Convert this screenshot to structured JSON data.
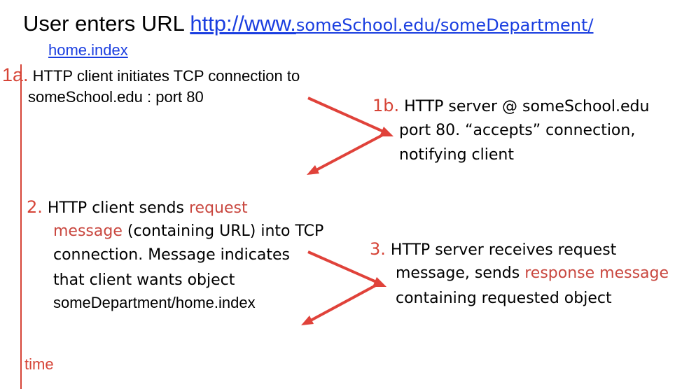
{
  "header": {
    "prefix": "User enters URL ",
    "url_part1": "http://www.",
    "url_part2": "someSchool.edu/someDepartment/",
    "url_part3": "home.index"
  },
  "step1a": {
    "num": "1a.",
    "line1": " HTTP client initiates TCP connection to",
    "line2": "someSchool.edu : port 80"
  },
  "step1b": {
    "num": "1b.",
    "line1": " HTTP server @ someSchool.edu",
    "line2": "port 80.  “accepts” connection,",
    "line3": "notifying client"
  },
  "step2": {
    "num": "2.",
    "line1_a": " HTTP client sends ",
    "line1_b": "request",
    "line2_a": "message",
    "line2_b": " (containing URL) into TCP",
    "line3": "connection. Message indicates",
    "line4": "that client wants object",
    "line5": "someDepartment/home.index"
  },
  "step3": {
    "num": "3.",
    "line1": " HTTP server receives request",
    "line2_a": "message, sends ",
    "line2_b": "response message",
    "line3": "containing requested object"
  },
  "timeline": {
    "label": "time"
  },
  "colors": {
    "accent_red": "#d64437",
    "link_blue": "#1a3ee0"
  }
}
